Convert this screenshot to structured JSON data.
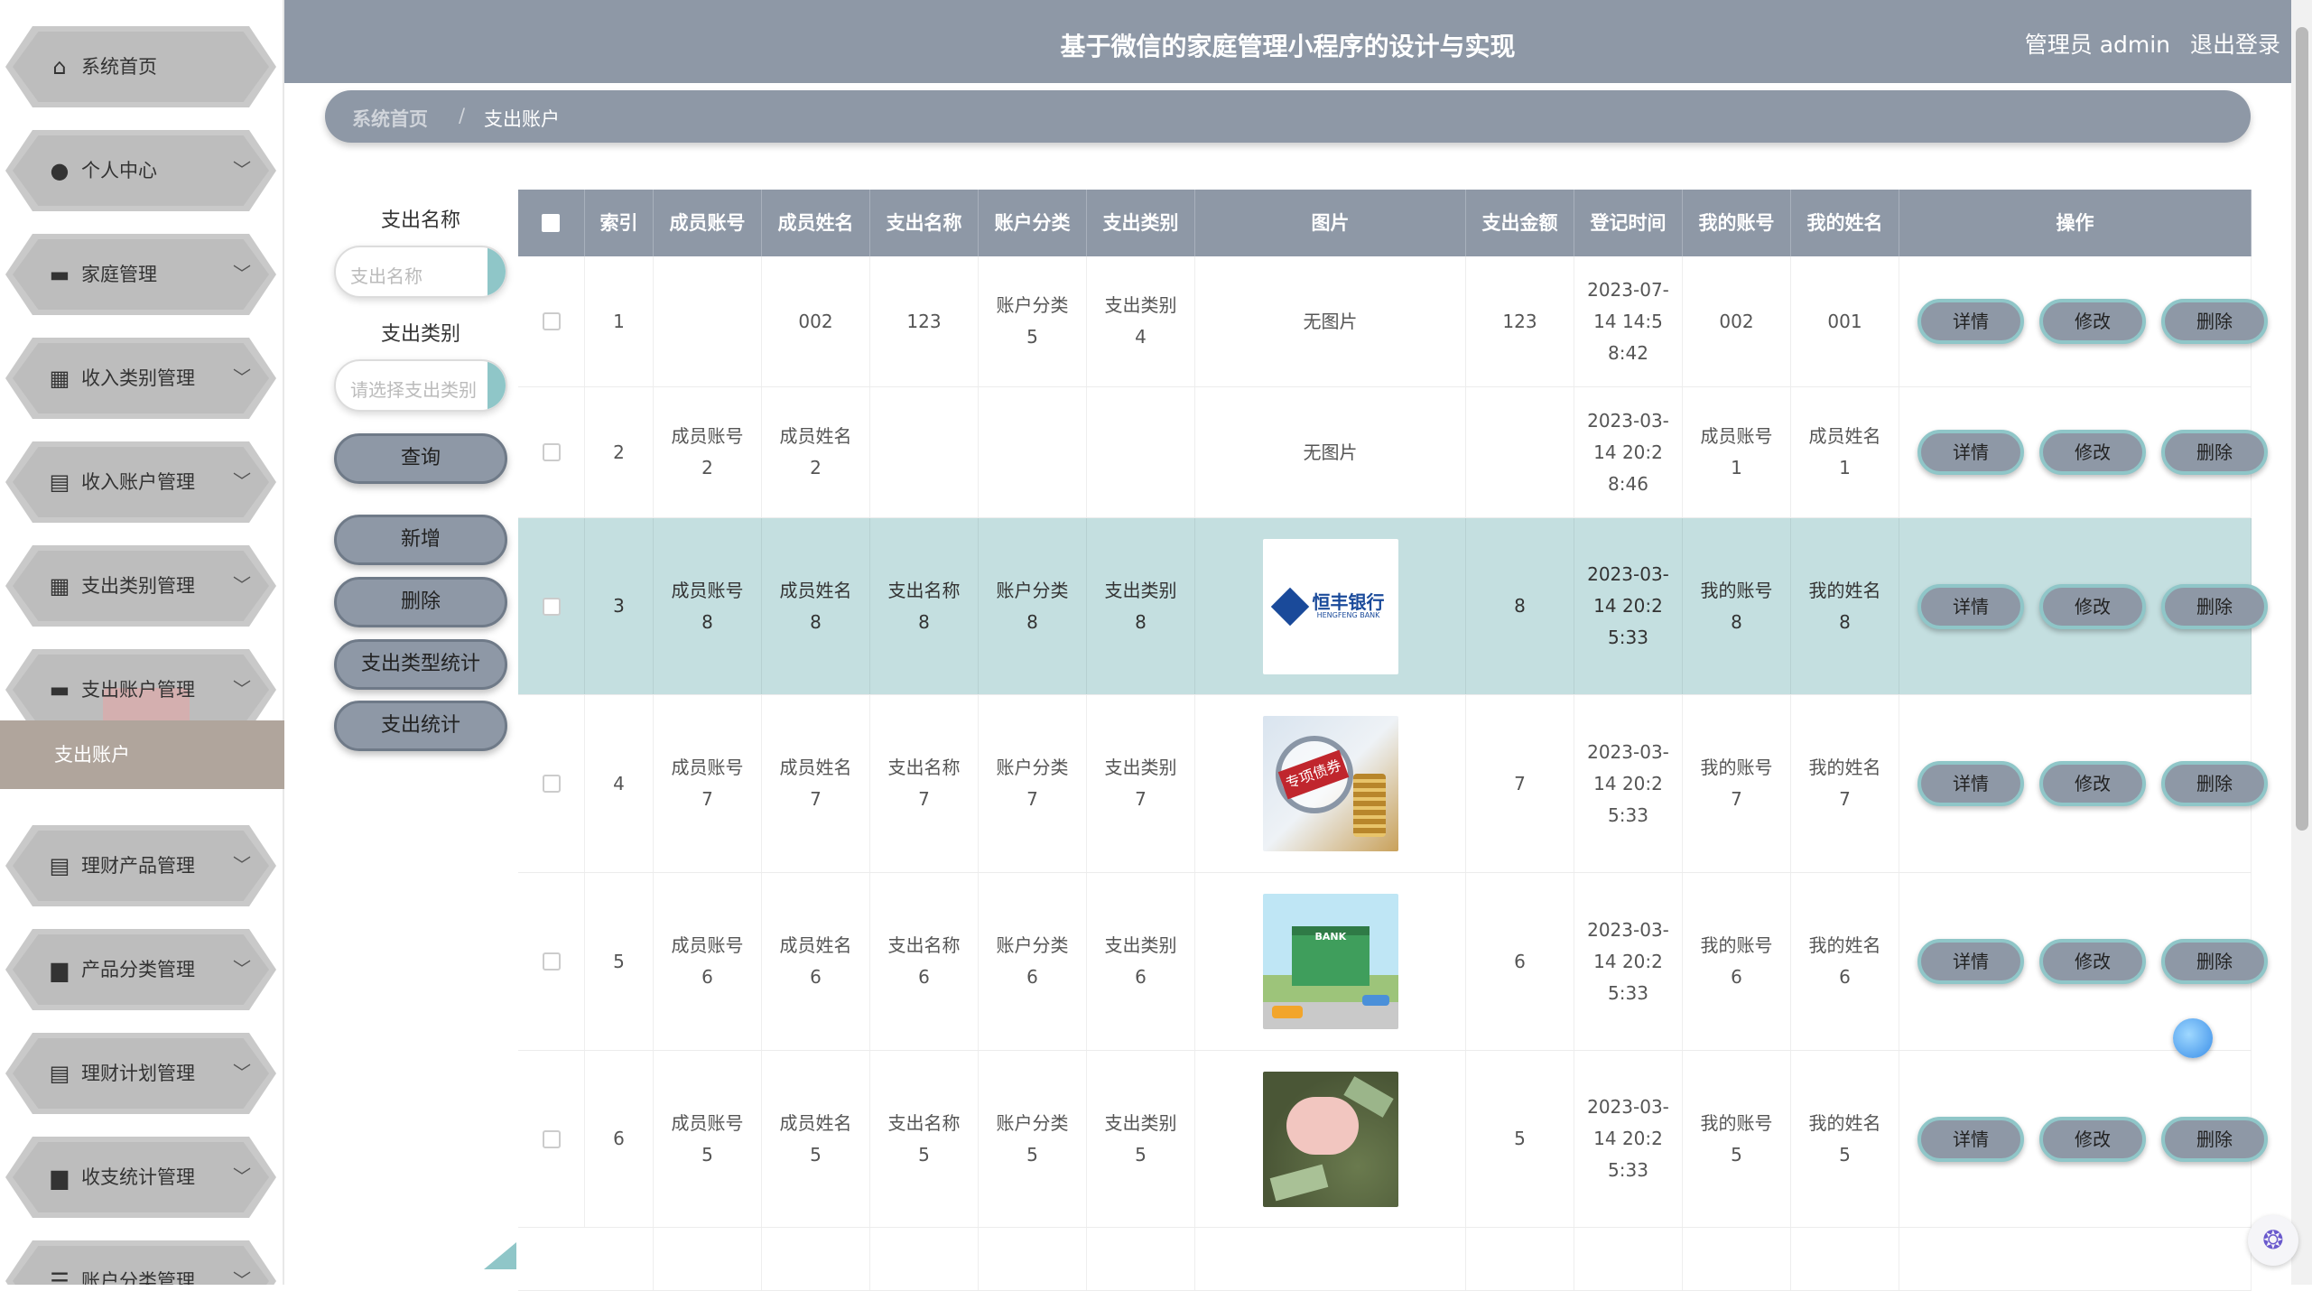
{
  "header": {
    "title": "基于微信的家庭管理小程序的设计与实现",
    "user": "管理员 admin",
    "logout": "退出登录"
  },
  "breadcrumb": {
    "home": "系统首页",
    "sep": "/",
    "current": "支出账户"
  },
  "sidebar": {
    "items": [
      {
        "label": "系统首页",
        "icon": "home-icon",
        "glyph": "⌂",
        "chevron": ""
      },
      {
        "label": "个人中心",
        "icon": "user-icon",
        "glyph": "●",
        "chevron": "﹀"
      },
      {
        "label": "家庭管理",
        "icon": "family-icon",
        "glyph": "▬",
        "chevron": "﹀"
      },
      {
        "label": "收入类别管理",
        "icon": "grid-icon",
        "glyph": "▦",
        "chevron": "﹀"
      },
      {
        "label": "收入账户管理",
        "icon": "clipboard-icon",
        "glyph": "▤",
        "chevron": "﹀"
      },
      {
        "label": "支出类别管理",
        "icon": "grid-icon",
        "glyph": "▦",
        "chevron": "﹀"
      },
      {
        "label": "支出账户管理",
        "icon": "list-icon",
        "glyph": "▬",
        "chevron": "﹀"
      },
      {
        "label": "理财产品管理",
        "icon": "clipboard-check-icon",
        "glyph": "▤",
        "chevron": "﹀"
      },
      {
        "label": "产品分类管理",
        "icon": "briefcase-icon",
        "glyph": "▆",
        "chevron": "﹀"
      },
      {
        "label": "理财计划管理",
        "icon": "clipboard-x-icon",
        "glyph": "▤",
        "chevron": "﹀"
      },
      {
        "label": "收支统计管理",
        "icon": "inbox-icon",
        "glyph": "▆",
        "chevron": "﹀"
      },
      {
        "label": "账户分类管理",
        "icon": "menu-icon",
        "glyph": "☰",
        "chevron": "﹀"
      }
    ],
    "submenu": {
      "label": "支出账户"
    }
  },
  "filter": {
    "name_label": "支出名称",
    "name_placeholder": "支出名称",
    "type_label": "支出类别",
    "type_placeholder": "请选择支出类别",
    "query": "查询",
    "add": "新增",
    "delete": "删除",
    "type_stats": "支出类型统计",
    "stats": "支出统计"
  },
  "table": {
    "columns": [
      "索引",
      "成员账号",
      "成员姓名",
      "支出名称",
      "账户分类",
      "支出类别",
      "图片",
      "支出金额",
      "登记时间",
      "我的账号",
      "我的姓名",
      "操作"
    ],
    "actions": {
      "detail": "详情",
      "edit": "修改",
      "delete": "删除"
    },
    "rows": [
      {
        "index": "1",
        "member_account": "",
        "member_name": "002",
        "expense_name": "123",
        "account_type": "账户分类5",
        "expense_type": "支出类别4",
        "image": "无图片",
        "amount": "123",
        "time": "2023-07-14 14:58:42",
        "my_account": "002",
        "my_name": "001"
      },
      {
        "index": "2",
        "member_account": "成员账号2",
        "member_name": "成员姓名2",
        "expense_name": "",
        "account_type": "",
        "expense_type": "",
        "image": "无图片",
        "amount": "",
        "time": "2023-03-14 20:28:46",
        "my_account": "成员账号1",
        "my_name": "成员姓名1"
      },
      {
        "index": "3",
        "member_account": "成员账号8",
        "member_name": "成员姓名8",
        "expense_name": "支出名称8",
        "account_type": "账户分类8",
        "expense_type": "支出类别8",
        "image": "hengfeng-bank-logo",
        "amount": "8",
        "time": "2023-03-14 20:25:33",
        "my_account": "我的账号8",
        "my_name": "我的姓名8"
      },
      {
        "index": "4",
        "member_account": "成员账号7",
        "member_name": "成员姓名7",
        "expense_name": "支出名称7",
        "account_type": "账户分类7",
        "expense_type": "支出类别7",
        "image": "magnifier-coins-photo",
        "amount": "7",
        "time": "2023-03-14 20:25:33",
        "my_account": "我的账号7",
        "my_name": "我的姓名7"
      },
      {
        "index": "5",
        "member_account": "成员账号6",
        "member_name": "成员姓名6",
        "expense_name": "支出名称6",
        "account_type": "账户分类6",
        "expense_type": "支出类别6",
        "image": "bank-building-illustration",
        "amount": "6",
        "time": "2023-03-14 20:25:33",
        "my_account": "我的账号6",
        "my_name": "我的姓名6"
      },
      {
        "index": "6",
        "member_account": "成员账号5",
        "member_name": "成员姓名5",
        "expense_name": "支出名称5",
        "account_type": "账户分类5",
        "expense_type": "支出类别5",
        "image": "piggy-bank-photo",
        "amount": "5",
        "time": "2023-03-14 20:25:33",
        "my_account": "我的账号5",
        "my_name": "我的姓名5"
      }
    ],
    "bank_logo_text": "恒丰银行",
    "bank_logo_sub": "HENGFENG BANK",
    "badge_text": "专项债券",
    "bank_sign": "BANK"
  },
  "colors": {
    "header": "#8e98a6",
    "accent": "#8fc6c8",
    "selected_row": "#c4dfe0",
    "sidebar_item": "#c9c9c9"
  }
}
